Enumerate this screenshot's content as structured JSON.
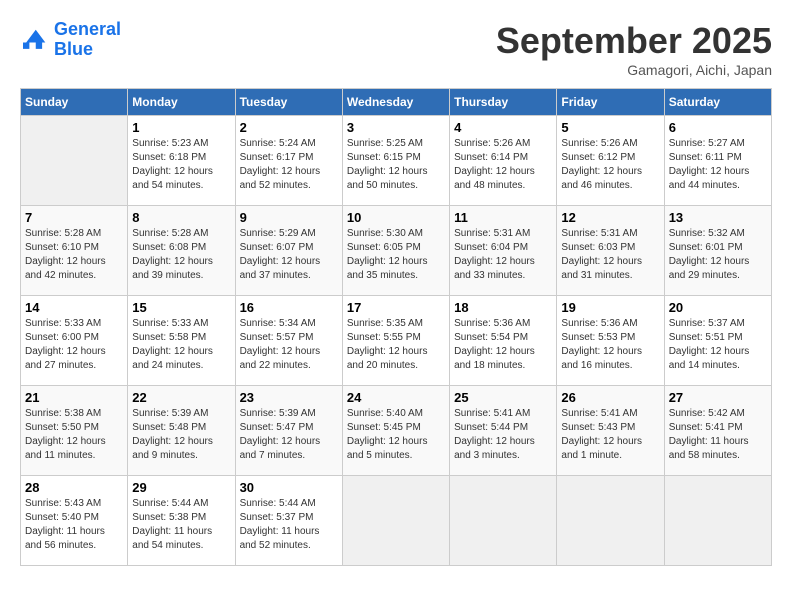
{
  "header": {
    "logo_line1": "General",
    "logo_line2": "Blue",
    "month": "September 2025",
    "location": "Gamagori, Aichi, Japan"
  },
  "weekdays": [
    "Sunday",
    "Monday",
    "Tuesday",
    "Wednesday",
    "Thursday",
    "Friday",
    "Saturday"
  ],
  "weeks": [
    [
      {
        "day": "",
        "info": ""
      },
      {
        "day": "1",
        "info": "Sunrise: 5:23 AM\nSunset: 6:18 PM\nDaylight: 12 hours\nand 54 minutes."
      },
      {
        "day": "2",
        "info": "Sunrise: 5:24 AM\nSunset: 6:17 PM\nDaylight: 12 hours\nand 52 minutes."
      },
      {
        "day": "3",
        "info": "Sunrise: 5:25 AM\nSunset: 6:15 PM\nDaylight: 12 hours\nand 50 minutes."
      },
      {
        "day": "4",
        "info": "Sunrise: 5:26 AM\nSunset: 6:14 PM\nDaylight: 12 hours\nand 48 minutes."
      },
      {
        "day": "5",
        "info": "Sunrise: 5:26 AM\nSunset: 6:12 PM\nDaylight: 12 hours\nand 46 minutes."
      },
      {
        "day": "6",
        "info": "Sunrise: 5:27 AM\nSunset: 6:11 PM\nDaylight: 12 hours\nand 44 minutes."
      }
    ],
    [
      {
        "day": "7",
        "info": "Sunrise: 5:28 AM\nSunset: 6:10 PM\nDaylight: 12 hours\nand 42 minutes."
      },
      {
        "day": "8",
        "info": "Sunrise: 5:28 AM\nSunset: 6:08 PM\nDaylight: 12 hours\nand 39 minutes."
      },
      {
        "day": "9",
        "info": "Sunrise: 5:29 AM\nSunset: 6:07 PM\nDaylight: 12 hours\nand 37 minutes."
      },
      {
        "day": "10",
        "info": "Sunrise: 5:30 AM\nSunset: 6:05 PM\nDaylight: 12 hours\nand 35 minutes."
      },
      {
        "day": "11",
        "info": "Sunrise: 5:31 AM\nSunset: 6:04 PM\nDaylight: 12 hours\nand 33 minutes."
      },
      {
        "day": "12",
        "info": "Sunrise: 5:31 AM\nSunset: 6:03 PM\nDaylight: 12 hours\nand 31 minutes."
      },
      {
        "day": "13",
        "info": "Sunrise: 5:32 AM\nSunset: 6:01 PM\nDaylight: 12 hours\nand 29 minutes."
      }
    ],
    [
      {
        "day": "14",
        "info": "Sunrise: 5:33 AM\nSunset: 6:00 PM\nDaylight: 12 hours\nand 27 minutes."
      },
      {
        "day": "15",
        "info": "Sunrise: 5:33 AM\nSunset: 5:58 PM\nDaylight: 12 hours\nand 24 minutes."
      },
      {
        "day": "16",
        "info": "Sunrise: 5:34 AM\nSunset: 5:57 PM\nDaylight: 12 hours\nand 22 minutes."
      },
      {
        "day": "17",
        "info": "Sunrise: 5:35 AM\nSunset: 5:55 PM\nDaylight: 12 hours\nand 20 minutes."
      },
      {
        "day": "18",
        "info": "Sunrise: 5:36 AM\nSunset: 5:54 PM\nDaylight: 12 hours\nand 18 minutes."
      },
      {
        "day": "19",
        "info": "Sunrise: 5:36 AM\nSunset: 5:53 PM\nDaylight: 12 hours\nand 16 minutes."
      },
      {
        "day": "20",
        "info": "Sunrise: 5:37 AM\nSunset: 5:51 PM\nDaylight: 12 hours\nand 14 minutes."
      }
    ],
    [
      {
        "day": "21",
        "info": "Sunrise: 5:38 AM\nSunset: 5:50 PM\nDaylight: 12 hours\nand 11 minutes."
      },
      {
        "day": "22",
        "info": "Sunrise: 5:39 AM\nSunset: 5:48 PM\nDaylight: 12 hours\nand 9 minutes."
      },
      {
        "day": "23",
        "info": "Sunrise: 5:39 AM\nSunset: 5:47 PM\nDaylight: 12 hours\nand 7 minutes."
      },
      {
        "day": "24",
        "info": "Sunrise: 5:40 AM\nSunset: 5:45 PM\nDaylight: 12 hours\nand 5 minutes."
      },
      {
        "day": "25",
        "info": "Sunrise: 5:41 AM\nSunset: 5:44 PM\nDaylight: 12 hours\nand 3 minutes."
      },
      {
        "day": "26",
        "info": "Sunrise: 5:41 AM\nSunset: 5:43 PM\nDaylight: 12 hours\nand 1 minute."
      },
      {
        "day": "27",
        "info": "Sunrise: 5:42 AM\nSunset: 5:41 PM\nDaylight: 11 hours\nand 58 minutes."
      }
    ],
    [
      {
        "day": "28",
        "info": "Sunrise: 5:43 AM\nSunset: 5:40 PM\nDaylight: 11 hours\nand 56 minutes."
      },
      {
        "day": "29",
        "info": "Sunrise: 5:44 AM\nSunset: 5:38 PM\nDaylight: 11 hours\nand 54 minutes."
      },
      {
        "day": "30",
        "info": "Sunrise: 5:44 AM\nSunset: 5:37 PM\nDaylight: 11 hours\nand 52 minutes."
      },
      {
        "day": "",
        "info": ""
      },
      {
        "day": "",
        "info": ""
      },
      {
        "day": "",
        "info": ""
      },
      {
        "day": "",
        "info": ""
      }
    ]
  ]
}
